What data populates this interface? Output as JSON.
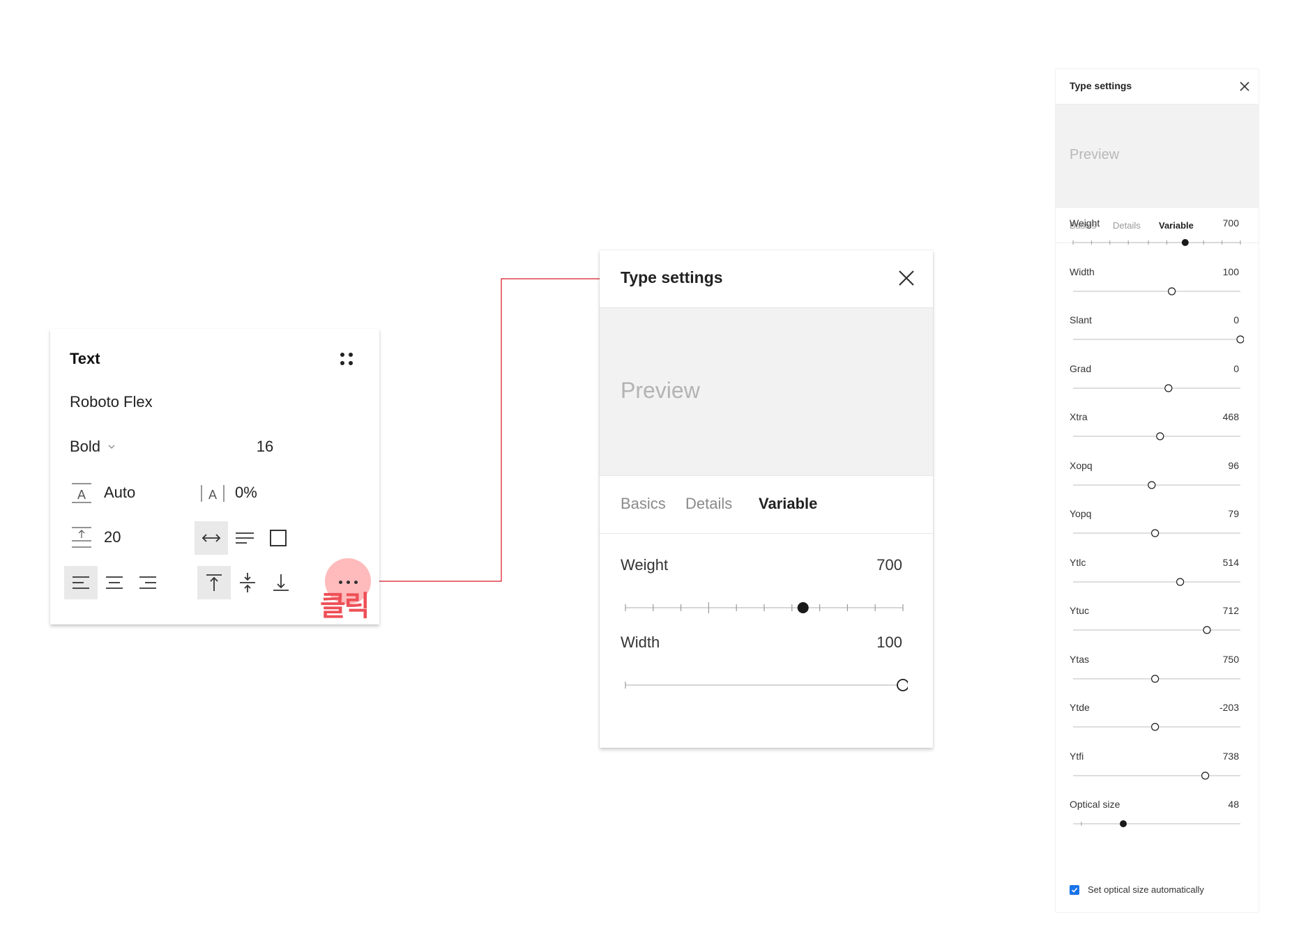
{
  "text_panel": {
    "title": "Text",
    "font_family": "Roboto Flex",
    "font_weight": "Bold",
    "font_size": "16",
    "letter_size_value": "Auto",
    "letter_spacing_value": "0%",
    "line_height_value": "20",
    "annotation": "클릭"
  },
  "type_settings_mid": {
    "title": "Type settings",
    "preview": "Preview",
    "tabs": [
      {
        "label": "Basics",
        "active": false
      },
      {
        "label": "Details",
        "active": false
      },
      {
        "label": "Variable",
        "active": true
      }
    ],
    "params": [
      {
        "label": "Weight",
        "value": "700",
        "pos": 0.64,
        "filled": true,
        "ticks": [
          0,
          0.1,
          0.2,
          0.3,
          0.4,
          0.5,
          0.6,
          0.7,
          0.8,
          0.9,
          1.0
        ],
        "major_ticks": [
          0.3
        ]
      },
      {
        "label": "Width",
        "value": "100",
        "pos": 1.0,
        "filled": false,
        "ticks": [
          0
        ],
        "major_ticks": []
      }
    ]
  },
  "type_settings_right": {
    "title": "Type settings",
    "preview": "Preview",
    "tabs": [
      {
        "label": "Basics",
        "active": false
      },
      {
        "label": "Details",
        "active": false
      },
      {
        "label": "Variable",
        "active": true
      }
    ],
    "params": [
      {
        "label": "Weight",
        "value": "700",
        "pos": 0.67,
        "filled": true,
        "ticks": [
          0,
          0.11,
          0.22,
          0.33,
          0.45,
          0.56,
          0.67,
          0.78,
          0.89,
          1.0
        ]
      },
      {
        "label": "Width",
        "value": "100",
        "pos": 0.59,
        "filled": false,
        "ticks": []
      },
      {
        "label": "Slant",
        "value": "0",
        "pos": 1.0,
        "filled": false,
        "ticks": []
      },
      {
        "label": "Grad",
        "value": "0",
        "pos": 0.57,
        "filled": false,
        "ticks": []
      },
      {
        "label": "Xtra",
        "value": "468",
        "pos": 0.52,
        "filled": false,
        "ticks": []
      },
      {
        "label": "Xopq",
        "value": "96",
        "pos": 0.47,
        "filled": false,
        "ticks": []
      },
      {
        "label": "Yopq",
        "value": "79",
        "pos": 0.49,
        "filled": false,
        "ticks": []
      },
      {
        "label": "Ytlc",
        "value": "514",
        "pos": 0.64,
        "filled": false,
        "ticks": []
      },
      {
        "label": "Ytuc",
        "value": "712",
        "pos": 0.8,
        "filled": false,
        "ticks": []
      },
      {
        "label": "Ytas",
        "value": "750",
        "pos": 0.49,
        "filled": false,
        "ticks": []
      },
      {
        "label": "Ytde",
        "value": "-203",
        "pos": 0.49,
        "filled": false,
        "ticks": []
      },
      {
        "label": "Ytfi",
        "value": "738",
        "pos": 0.79,
        "filled": false,
        "ticks": []
      },
      {
        "label": "Optical size",
        "value": "48",
        "pos": 0.3,
        "filled": true,
        "ticks": [
          0.05
        ]
      }
    ],
    "optical_checkbox_label": "Set optical size automatically",
    "optical_checked": true
  },
  "colors": {
    "accent_checkbox": "#1a73e8",
    "annotation_red": "#ee4f57",
    "connector_red": "#e0404a",
    "highlight_pink": "#ff9696"
  }
}
